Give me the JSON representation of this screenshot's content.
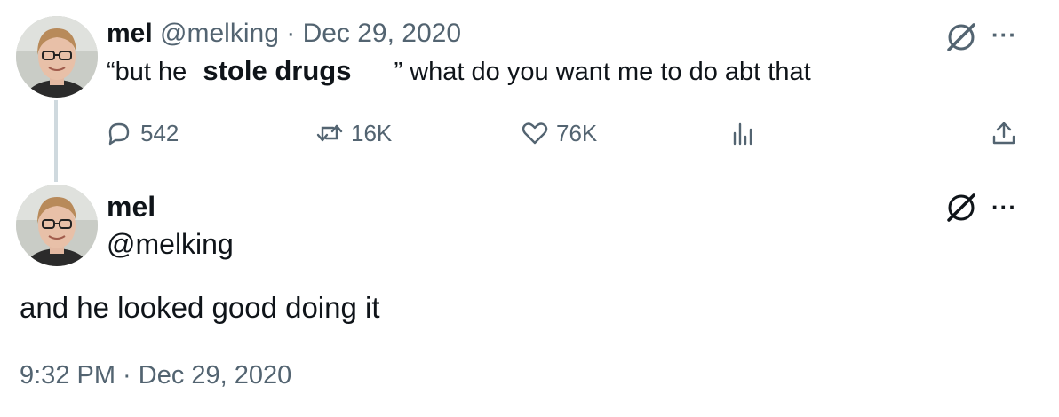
{
  "tweet1": {
    "name": "mel",
    "handle": "@melking",
    "separator": "·",
    "date": "Dec 29, 2020",
    "text_before": "“but he",
    "text_edited": "stole drugs",
    "text_after": "” what do you want me to do abt that",
    "actions": {
      "replies": "542",
      "reposts": "16K",
      "likes": "76K"
    }
  },
  "tweet2": {
    "name": "mel",
    "handle": "@melking",
    "text": "and he looked good doing it",
    "timestamp": "9:32 PM · Dec 29, 2020"
  },
  "icons": {
    "more": "···",
    "grok": "grok-icon",
    "reply": "reply-icon",
    "repost": "repost-icon",
    "like": "heart-icon",
    "views": "views-icon",
    "share": "share-icon"
  },
  "colors": {
    "text": "#0f1419",
    "muted": "#536471",
    "thread_line": "#cfd9de"
  }
}
